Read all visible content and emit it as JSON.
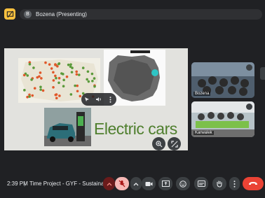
{
  "app": {
    "presenter_initial": "B",
    "presenter_label": "Bozena (Presenting)"
  },
  "slide": {
    "title": "Electric cars"
  },
  "participants": [
    {
      "name": "Bozena"
    },
    {
      "name": "Karwalek"
    }
  ],
  "bottom_bar": {
    "time": "2:39 PM",
    "separator": "|",
    "meeting_title": "Time Project - GYF - Sustaina..."
  },
  "icons": {
    "app_logo": "present-screen-icon",
    "controls": [
      "pointer-icon",
      "volume-icon",
      "more-vert-icon"
    ],
    "corner": [
      "zoom-icon",
      "fullscreen-icon"
    ],
    "toolbar": [
      "chevron-up-icon",
      "mic-off-icon",
      "chevron-up-icon",
      "camera-icon",
      "present-icon",
      "emoji-icon",
      "captions-icon",
      "raise-hand-icon",
      "more-vert-icon",
      "end-call-icon"
    ]
  },
  "colors": {
    "end_call": "#ea4335",
    "slide_title": "#4f7f2e",
    "logo": "#f9c13f"
  }
}
